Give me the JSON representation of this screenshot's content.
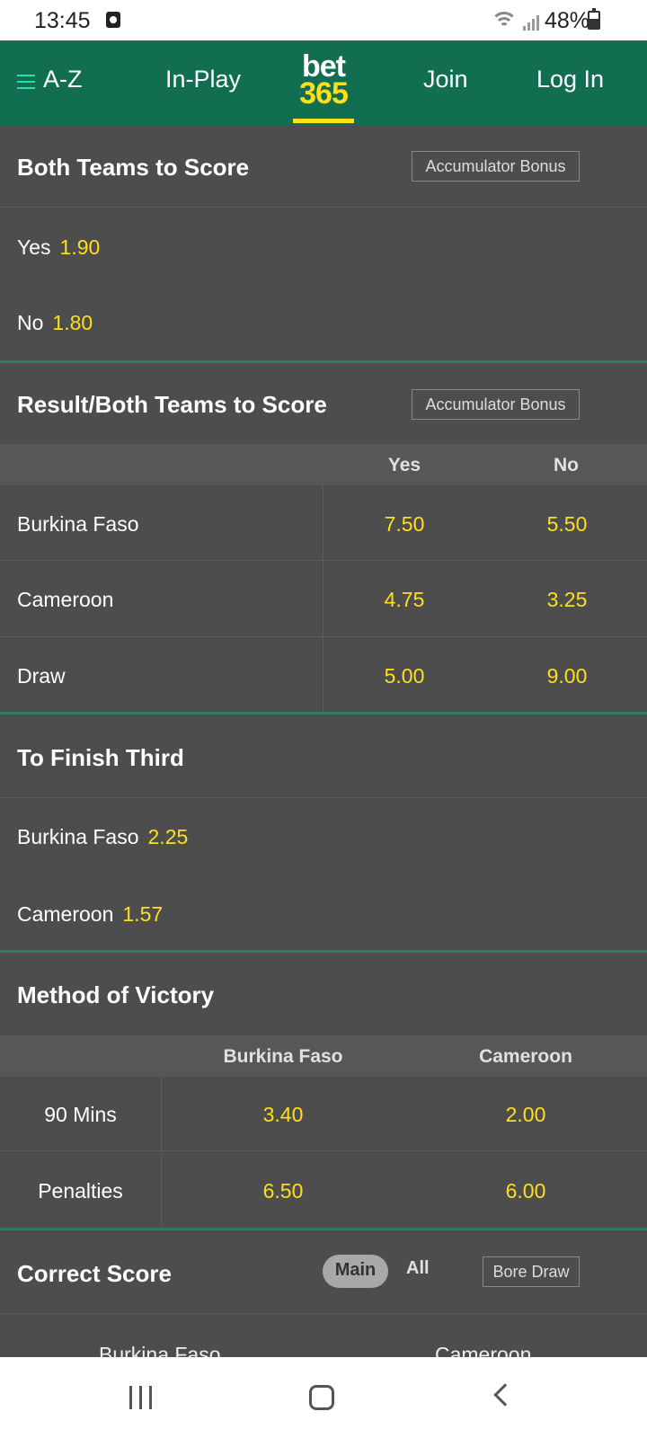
{
  "status_bar": {
    "time": "13:45",
    "battery": "48%"
  },
  "header": {
    "menu_label": "A-Z",
    "inplay": "In-Play",
    "logo_top": "bet",
    "logo_bottom": "365",
    "join": "Join",
    "login": "Log In"
  },
  "btts": {
    "title": "Both Teams to Score",
    "acc_bonus": "Accumulator Bonus",
    "options": [
      {
        "label": "Yes",
        "odds": "1.90"
      },
      {
        "label": "No",
        "odds": "1.80"
      }
    ]
  },
  "result_btts": {
    "title": "Result/Both Teams to Score",
    "acc_bonus": "Accumulator Bonus",
    "columns": [
      "Yes",
      "No"
    ],
    "rows": [
      {
        "label": "Burkina Faso",
        "yes": "7.50",
        "no": "5.50"
      },
      {
        "label": "Cameroon",
        "yes": "4.75",
        "no": "3.25"
      },
      {
        "label": "Draw",
        "yes": "5.00",
        "no": "9.00"
      }
    ]
  },
  "finish_third": {
    "title": "To Finish Third",
    "options": [
      {
        "label": "Burkina Faso",
        "odds": "2.25"
      },
      {
        "label": "Cameroon",
        "odds": "1.57"
      }
    ]
  },
  "method_victory": {
    "title": "Method of Victory",
    "columns": [
      "Burkina Faso",
      "Cameroon"
    ],
    "rows": [
      {
        "label": "90 Mins",
        "a": "3.40",
        "b": "2.00"
      },
      {
        "label": "Penalties",
        "a": "6.50",
        "b": "6.00"
      }
    ]
  },
  "correct_score": {
    "title": "Correct Score",
    "tab_main": "Main",
    "tab_all": "All",
    "bore_draw": "Bore Draw",
    "team_a": "Burkina Faso",
    "team_b": "Cameroon"
  }
}
